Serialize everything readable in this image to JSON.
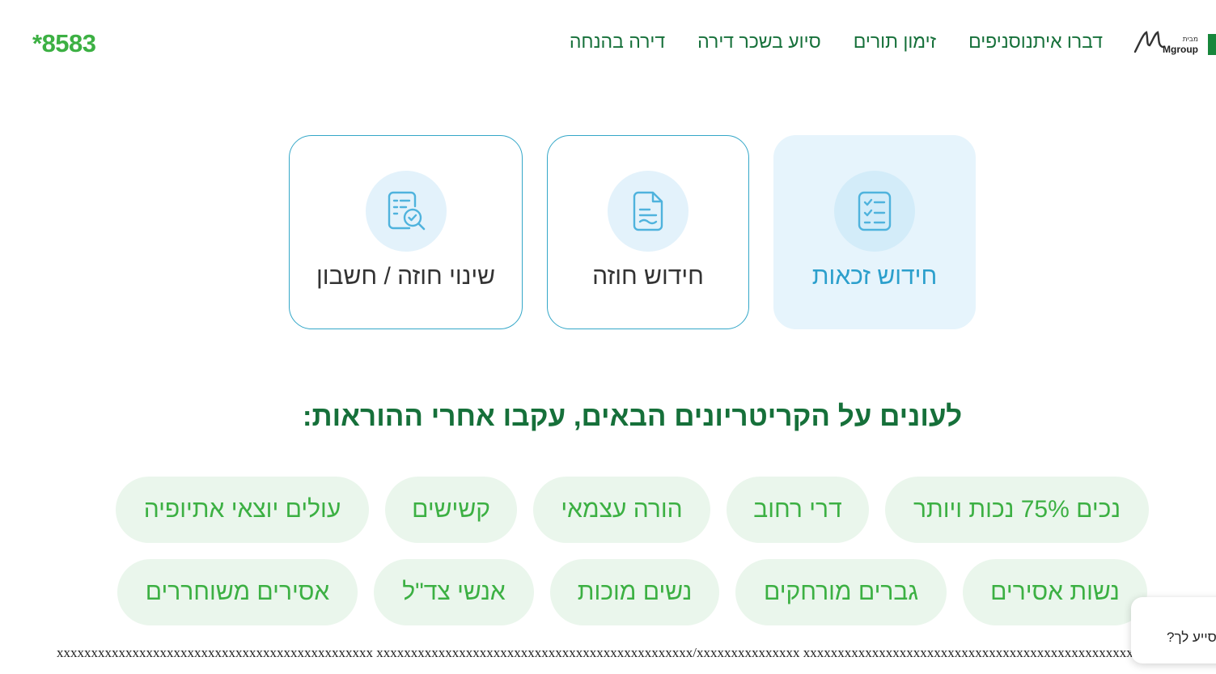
{
  "header": {
    "phone": "*8583",
    "nav": [
      {
        "label": "דירה בהנחה"
      },
      {
        "label": "סיוע בשכר דירה"
      },
      {
        "label": "זימון תורים"
      },
      {
        "label": "סניפים"
      },
      {
        "label": "דברו איתנו"
      }
    ],
    "logo": {
      "tag": "מבית",
      "name": "Mgroup"
    }
  },
  "services": [
    {
      "label": "חידוש זכאות",
      "icon": "checklist-icon",
      "active": true
    },
    {
      "label": "חידוש חוזה",
      "icon": "document-icon",
      "active": false
    },
    {
      "label": "שינוי חוזה / חשבון",
      "icon": "document-search-icon",
      "active": false
    }
  ],
  "criteria": {
    "heading": "לעונים על הקריטריונים הבאים, עקבו אחרי ההוראות:",
    "items": [
      "נכים 75% נכות ויותר",
      "דרי רחוב",
      "הורה עצמאי",
      "קשישים",
      "עולים יוצאי אתיופיה",
      "נשות אסירים",
      "גברים מורחקים",
      "נשים מוכות",
      "אנשי צד\"ל",
      "אסירים משוחררים"
    ]
  },
  "placeholder_text": "xxxxxxxxxxxxxxxxxxxxxxxxxxxxxxxxxxxxxxxxxxxxxx xxxxxxxxxxxxxxxxxxxxxxxxxxxxxxxxxxxxxxxxxxxxxx/xxxxxxxxxxxxxxx xxxxxxxxxxxxxxxxxxxxxxxxxxxxxxxxxxxxxxxxxxxxxxxxxxxxxxxxxx",
  "chat": {
    "text": "סייע לך?"
  },
  "colors": {
    "brand_green": "#16703a",
    "accent_green": "#3cb043",
    "pill_bg": "#eaf6ec",
    "card_blue": "#2b9fcc",
    "card_active_bg": "#e6f4fc"
  }
}
